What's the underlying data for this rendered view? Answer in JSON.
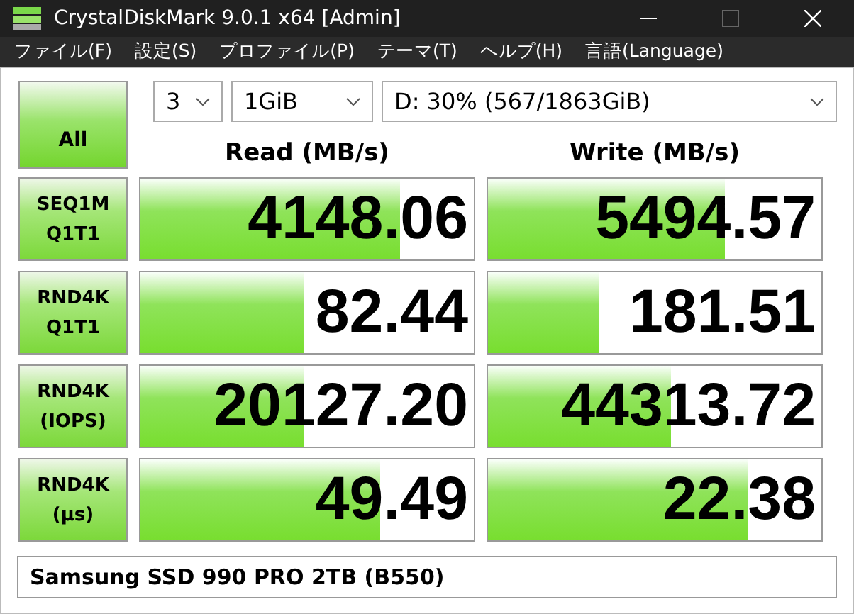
{
  "window": {
    "title": "CrystalDiskMark 9.0.1 x64 [Admin]"
  },
  "menu": [
    "ファイル(F)",
    "設定(S)",
    "プロファイル(P)",
    "テーマ(T)",
    "ヘルプ(H)",
    "言語(Language)"
  ],
  "controls": {
    "all_button": "All",
    "count": "3",
    "size": "1GiB",
    "drive": "D: 30% (567/1863GiB)"
  },
  "columns": [
    "Read (MB/s)",
    "Write (MB/s)"
  ],
  "rows": [
    {
      "label_1": "SEQ1M",
      "label_2": "Q1T1",
      "read": {
        "value": "4148.06",
        "level": 0.78
      },
      "write": {
        "value": "5494.57",
        "level": 0.71
      }
    },
    {
      "label_1": "RND4K",
      "label_2": "Q1T1",
      "read": {
        "value": "82.44",
        "level": 0.49
      },
      "write": {
        "value": "181.51",
        "level": 0.33
      }
    },
    {
      "label_1": "RND4K",
      "label_2": "(IOPS)",
      "read": {
        "value": "20127.20",
        "level": 0.49
      },
      "write": {
        "value": "44313.72",
        "level": 0.55
      }
    },
    {
      "label_1": "RND4K",
      "label_2": "(μs)",
      "read": {
        "value": "49.49",
        "level": 0.72
      },
      "write": {
        "value": "22.38",
        "level": 0.78
      }
    }
  ],
  "footer": "Samsung SSD 990 PRO 2TB (B550)"
}
